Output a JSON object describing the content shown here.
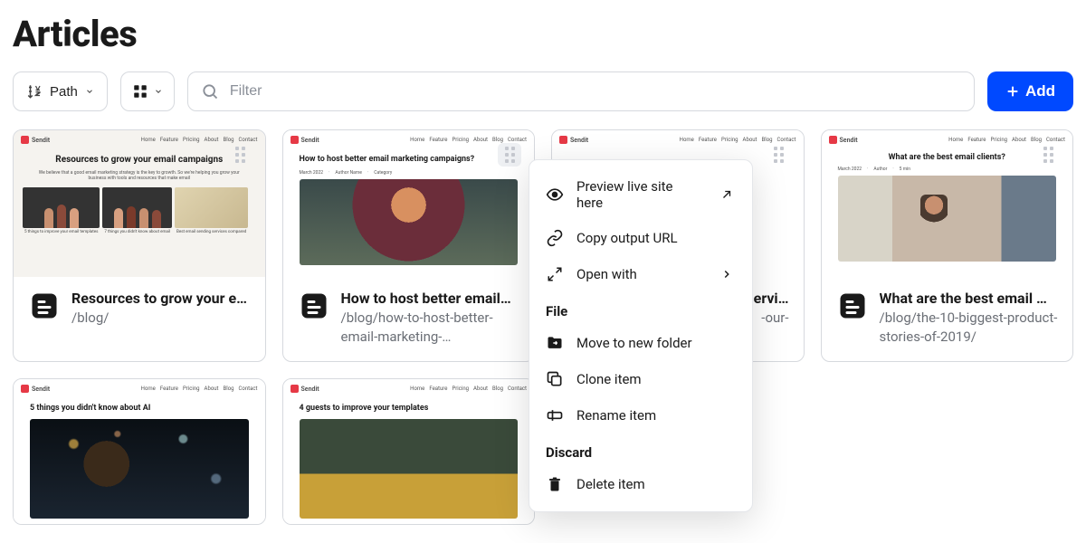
{
  "page": {
    "title": "Articles"
  },
  "toolbar": {
    "sort_label": "Path",
    "filter_placeholder": "Filter",
    "add_label": "Add"
  },
  "thumb_nav": [
    "Home",
    "Feature",
    "Pricing",
    "About",
    "Blog",
    "Contact"
  ],
  "thumb_brand": "Sendit",
  "cards": [
    {
      "thumb_title": "Resources to grow your email campaigns",
      "thumb_sub": "We believe that a good email marketing strategy is the key to growth. So we're helping you grow your business with tools and resources that make email",
      "strip_caps": [
        "5 things to improve your email templates",
        "7 things you didn't know about email",
        "Best email sending services compared"
      ],
      "title": "Resources to grow your e…",
      "path": "/blog/"
    },
    {
      "thumb_title": "How to host better email marketing campaigns?",
      "title": "How to host better email…",
      "path": "/blog/how-to-host-better-email-marketing-…"
    },
    {
      "title_suffix": "ervi…",
      "path_suffix": "-our-"
    },
    {
      "thumb_title": "What are the best email clients?",
      "title": "What are the best email …",
      "path": "/blog/the-10-biggest-product-stories-of-2019/"
    },
    {
      "thumb_title": "5 things you didn't know about AI",
      "title": "",
      "path": ""
    },
    {
      "thumb_title": "4 guests to improve your templates",
      "title": "",
      "path": ""
    }
  ],
  "context_menu": {
    "preview": "Preview live site here",
    "copy_url": "Copy output URL",
    "open_with": "Open with",
    "section_file": "File",
    "move": "Move to new folder",
    "clone": "Clone item",
    "rename": "Rename item",
    "section_discard": "Discard",
    "delete": "Delete item"
  },
  "colors": {
    "primary": "#0049FF"
  }
}
